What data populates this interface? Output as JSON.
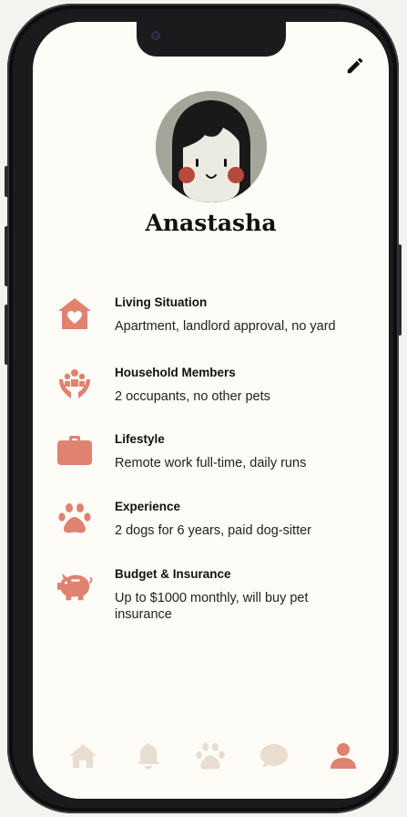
{
  "profile": {
    "name": "Anastasha"
  },
  "colors": {
    "accent": "#e08270",
    "nav_inactive": "#e9ddd0",
    "screen_bg": "#fdfcf6"
  },
  "details": [
    {
      "icon": "house-heart-icon",
      "title": "Living Situation",
      "desc": "Apartment, landlord approval, no yard"
    },
    {
      "icon": "people-hands-icon",
      "title": "Household Members",
      "desc": "2 occupants, no other pets"
    },
    {
      "icon": "briefcase-icon",
      "title": "Lifestyle",
      "desc": "Remote work full-time, daily runs"
    },
    {
      "icon": "paw-icon",
      "title": "Experience",
      "desc": "2 dogs for 6 years, paid dog-sitter"
    },
    {
      "icon": "piggy-bank-icon",
      "title": "Budget & Insurance",
      "desc": "Up to $1000 monthly, will buy pet insurance"
    }
  ],
  "nav": [
    {
      "icon": "home-icon",
      "active": false
    },
    {
      "icon": "bell-icon",
      "active": false
    },
    {
      "icon": "paw-icon",
      "active": false
    },
    {
      "icon": "chat-icon",
      "active": false
    },
    {
      "icon": "user-icon",
      "active": true
    }
  ]
}
